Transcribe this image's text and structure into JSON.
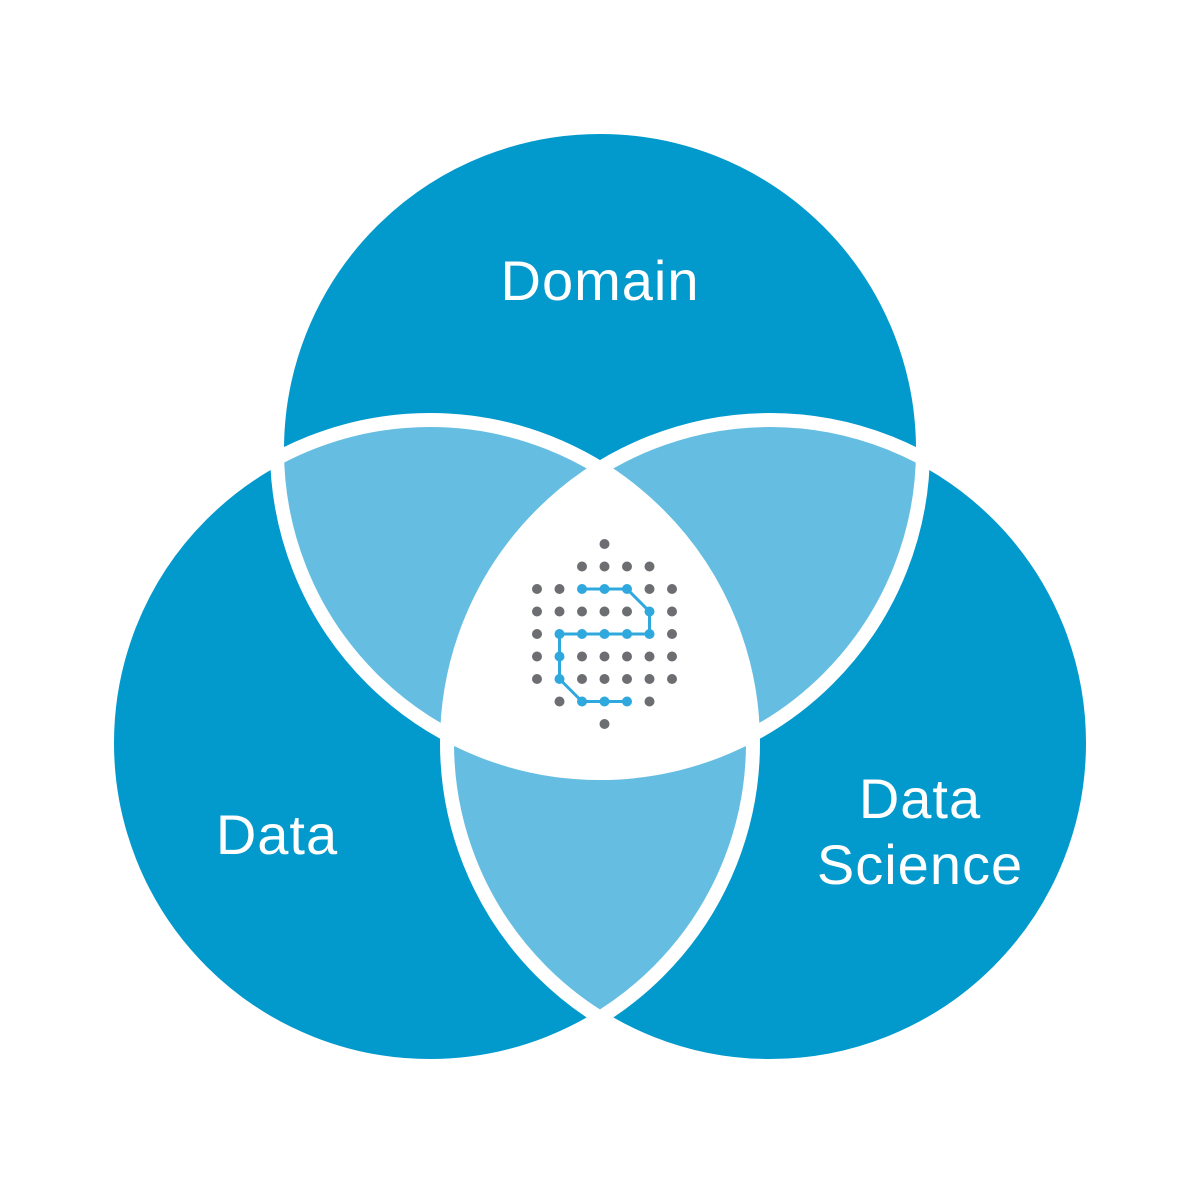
{
  "diagram": {
    "circles": [
      {
        "id": "domain",
        "label": "Domain"
      },
      {
        "id": "data",
        "label": "Data"
      },
      {
        "id": "data-science",
        "label_line1": "Data",
        "label_line2": "Science"
      }
    ],
    "colors": {
      "circle": "#0299CC",
      "overlap": "#65BEE2",
      "center": "#FFFFFF",
      "gap": "#FFFFFF",
      "logo_dot": "#6D6E71",
      "logo_path": "#2FA8DD"
    },
    "center_icon": "dot-grid-logo-icon"
  }
}
